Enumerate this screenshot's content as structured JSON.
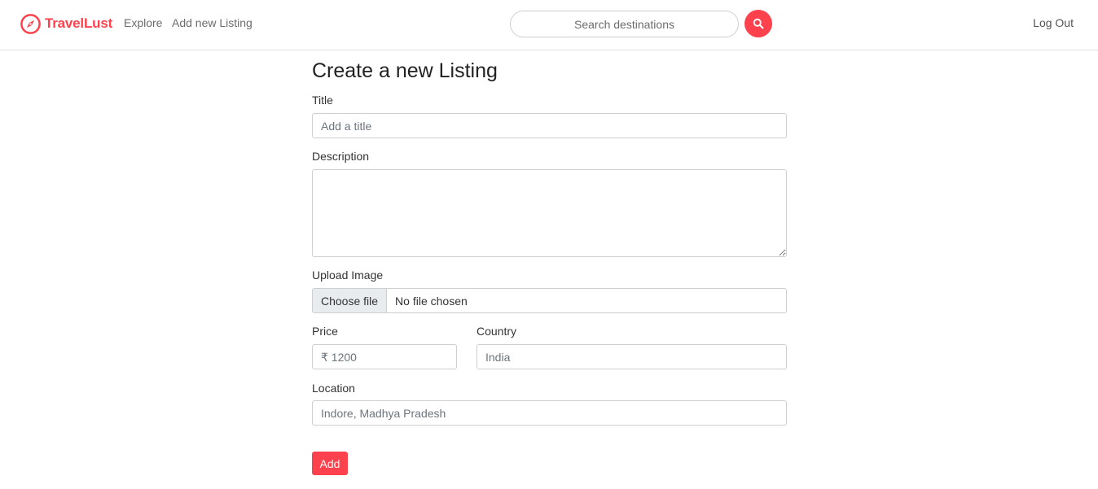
{
  "navbar": {
    "brand": "TravelLust",
    "links": {
      "explore": "Explore",
      "add_listing": "Add new Listing"
    },
    "search": {
      "placeholder": "Search destinations",
      "button_icon": "search-icon"
    },
    "logout": "Log Out",
    "brand_icon": "compass-icon"
  },
  "form": {
    "heading": "Create a new Listing",
    "title": {
      "label": "Title",
      "placeholder": "Add a title",
      "value": ""
    },
    "description": {
      "label": "Description",
      "value": ""
    },
    "image": {
      "label": "Upload Image",
      "button": "Choose file",
      "status": "No file chosen"
    },
    "price": {
      "label": "Price",
      "placeholder": "₹ 1200",
      "value": ""
    },
    "country": {
      "label": "Country",
      "placeholder": "India",
      "value": ""
    },
    "location": {
      "label": "Location",
      "placeholder": "Indore, Madhya Pradesh",
      "value": ""
    },
    "submit": "Add"
  },
  "colors": {
    "accent": "#fe424d",
    "border": "#cfcfcf",
    "text": "#222222",
    "muted": "#6c757d"
  }
}
